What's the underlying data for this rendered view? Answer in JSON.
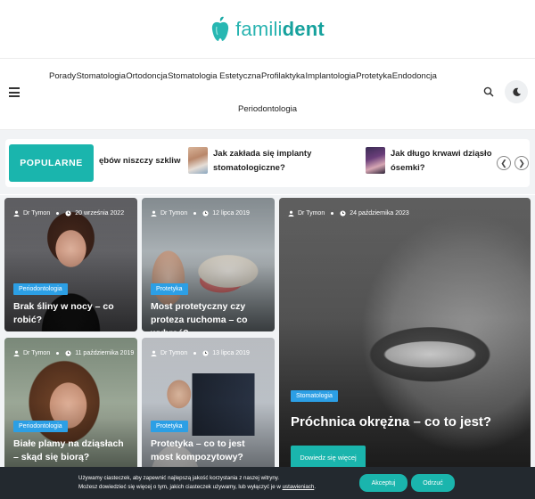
{
  "brand": {
    "logo_light": "famili",
    "logo_bold": "dent",
    "colors": {
      "accent": "#1ab5ad",
      "tag": "#2c9fe5",
      "cookie_bg": "#23292f"
    }
  },
  "nav": {
    "row1": [
      "Porady",
      "Stomatologia",
      "Ortodoncja",
      "Stomatologia Estetyczna",
      "Profilaktyka",
      "Implantologia",
      "Protetyka",
      "Endodoncja"
    ],
    "row2": [
      "Periodontologia"
    ],
    "icons": {
      "menu": "hamburger-icon",
      "search": "search-icon",
      "theme": "moon-icon"
    }
  },
  "popular": {
    "label": "POPULARNE",
    "partial_title": "ębów niszczy szkliwo?",
    "items": [
      {
        "title": "Jak zakłada się implanty stomatologiczne?"
      },
      {
        "title_line1": "Jak długo krwawi dziąsło po",
        "title_line2": "ósemki?"
      }
    ],
    "prev_icon": "chevron-left-icon",
    "next_icon": "chevron-right-icon"
  },
  "posts": [
    {
      "author": "Dr Tymon",
      "date": "20 września 2022",
      "category": "Periodontologia",
      "title": "Brak śliny w nocy – co robić?"
    },
    {
      "author": "Dr Tymon",
      "date": "12 lipca 2019",
      "category": "Protetyka",
      "title": "Most protetyczny czy proteza ruchoma – co wybrać?"
    },
    {
      "author": "Dr Tymon",
      "date": "11 października 2019",
      "category": "Periodontologia",
      "title": "Białe plamy na dziąsłach – skąd się biorą?"
    },
    {
      "author": "Dr Tymon",
      "date": "13 lipca 2019",
      "category": "Protetyka",
      "title": "Protetyka – co to jest most kompozytowy?"
    },
    {
      "author": "Dr Tymon",
      "date": "24 października 2023",
      "category": "Stomatologia",
      "title": "Próchnica okrężna – co to jest?",
      "button": "Dowiedz się więcej"
    }
  ],
  "cookie": {
    "line1": "Używamy ciasteczek, aby zapewnić najlepszą jakość korzystania z naszej witryny.",
    "line2_pre": "Możesz dowiedzieć się więcej o tym, jakich ciasteczek używamy, lub wyłączyć je w ",
    "line2_link": "ustawieniach",
    "line2_post": ".",
    "accept": "Akceptuj",
    "reject": "Odrzuć"
  }
}
